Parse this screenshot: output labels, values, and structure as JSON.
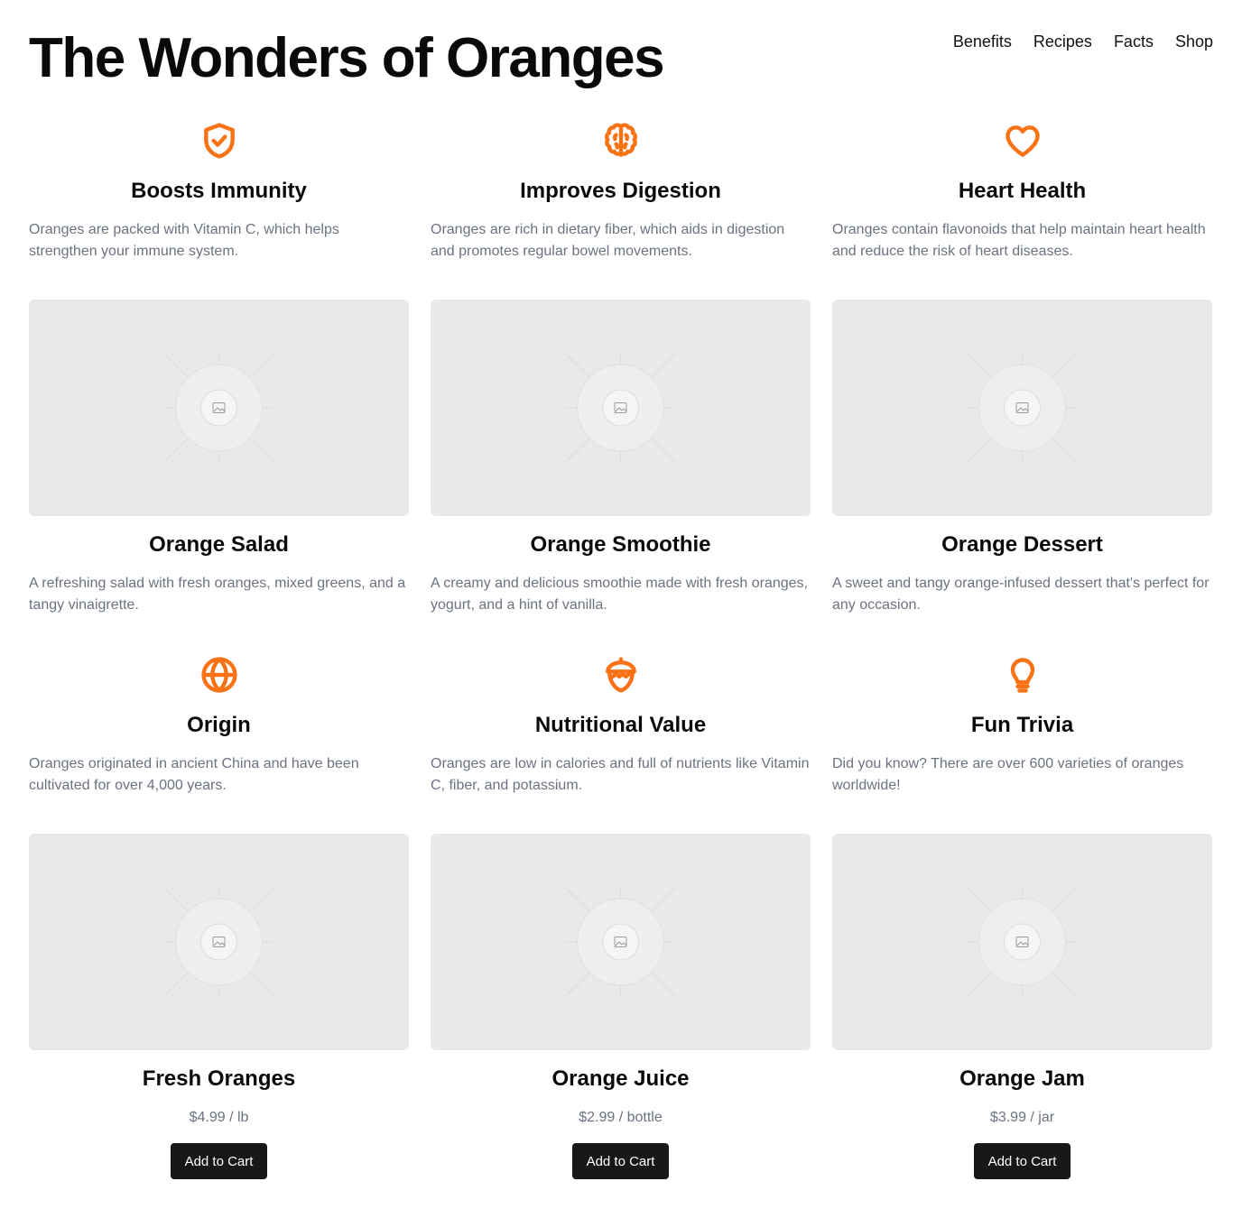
{
  "title": "The Wonders of Oranges",
  "nav": [
    "Benefits",
    "Recipes",
    "Facts",
    "Shop"
  ],
  "accent_color": "#f97316",
  "benefits": [
    {
      "icon": "shield-check-icon",
      "title": "Boosts Immunity",
      "desc": "Oranges are packed with Vitamin C, which helps strengthen your immune system."
    },
    {
      "icon": "brain-icon",
      "title": "Improves Digestion",
      "desc": "Oranges are rich in dietary fiber, which aids in digestion and promotes regular bowel movements."
    },
    {
      "icon": "heart-icon",
      "title": "Heart Health",
      "desc": "Oranges contain flavonoids that help maintain heart health and reduce the risk of heart diseases."
    }
  ],
  "recipes": [
    {
      "title": "Orange Salad",
      "desc": "A refreshing salad with fresh oranges, mixed greens, and a tangy vinaigrette."
    },
    {
      "title": "Orange Smoothie",
      "desc": "A creamy and delicious smoothie made with fresh oranges, yogurt, and a hint of vanilla."
    },
    {
      "title": "Orange Dessert",
      "desc": "A sweet and tangy orange-infused dessert that's perfect for any occasion."
    }
  ],
  "facts": [
    {
      "icon": "globe-icon",
      "title": "Origin",
      "desc": "Oranges originated in ancient China and have been cultivated for over 4,000 years."
    },
    {
      "icon": "acorn-icon",
      "title": "Nutritional Value",
      "desc": "Oranges are low in calories and full of nutrients like Vitamin C, fiber, and potassium."
    },
    {
      "icon": "lightbulb-icon",
      "title": "Fun Trivia",
      "desc": "Did you know? There are over 600 varieties of oranges worldwide!"
    }
  ],
  "products": [
    {
      "title": "Fresh Oranges",
      "price": "$4.99 / lb",
      "button": "Add to Cart"
    },
    {
      "title": "Orange Juice",
      "price": "$2.99 / bottle",
      "button": "Add to Cart"
    },
    {
      "title": "Orange Jam",
      "price": "$3.99 / jar",
      "button": "Add to Cart"
    }
  ]
}
